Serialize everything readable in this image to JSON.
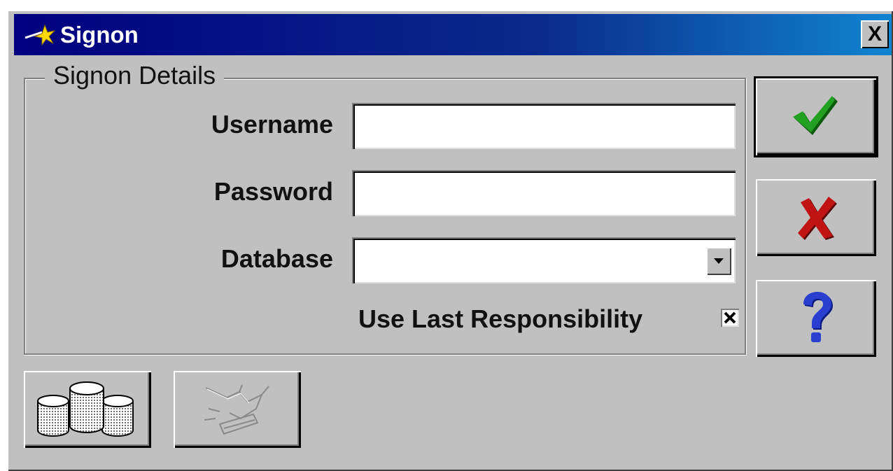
{
  "window": {
    "title": "Signon",
    "close_label": "X"
  },
  "group": {
    "title": "Signon Details"
  },
  "fields": {
    "username": {
      "label": "Username",
      "value": ""
    },
    "password": {
      "label": "Password",
      "value": ""
    },
    "database": {
      "label": "Database",
      "value": ""
    }
  },
  "checkbox": {
    "label": "Use Last Responsibility",
    "checked": true
  },
  "buttons": {
    "ok_icon": "check-icon",
    "cancel_icon": "x-icon",
    "help_icon": "question-icon",
    "database_icon": "database-icon",
    "disabled_icon": "hand-keyboard-icon"
  },
  "colors": {
    "titlebar": "#000080",
    "face": "#c0c0c0",
    "check": "#1a8a1a",
    "cross": "#b01010",
    "help": "#1a2fb0"
  }
}
